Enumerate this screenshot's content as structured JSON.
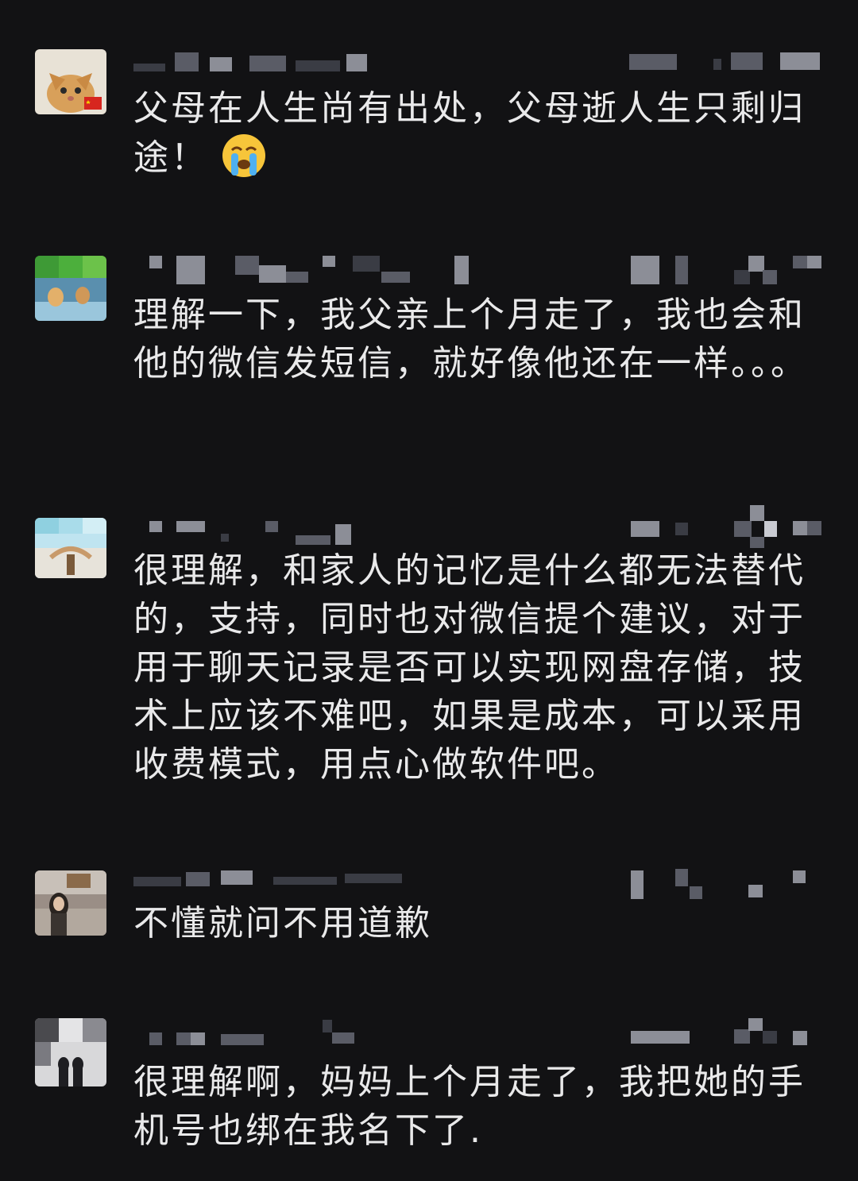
{
  "comments": [
    {
      "avatar_icon": "cat-avatar-icon",
      "text": "父母在人生尚有出处，父母逝人生只剩归途！",
      "emoji": "loudly-crying-face-icon"
    },
    {
      "avatar_icon": "beach-photo-avatar-icon",
      "text": "理解一下，我父亲上个月走了，我也会和他的微信发短信，就好像他还在一样。。。"
    },
    {
      "avatar_icon": "sky-photo-avatar-icon",
      "text": "很理解，和家人的记忆是什么都无法替代的，支持，同时也对微信提个建议，对于用于聊天记录是否可以实现网盘存储，技术上应该不难吧，如果是成本，可以采用收费模式，用点心做软件吧。"
    },
    {
      "avatar_icon": "person-photo-avatar-icon",
      "text": "不懂就问不用道歉"
    },
    {
      "avatar_icon": "couple-photo-avatar-icon",
      "text": "很理解啊，妈妈上个月走了，我把她的手机号也绑在我名下了."
    }
  ],
  "colors": {
    "background": "#121214",
    "text": "#e9e9ea",
    "mosaic": "#5a5c66"
  }
}
